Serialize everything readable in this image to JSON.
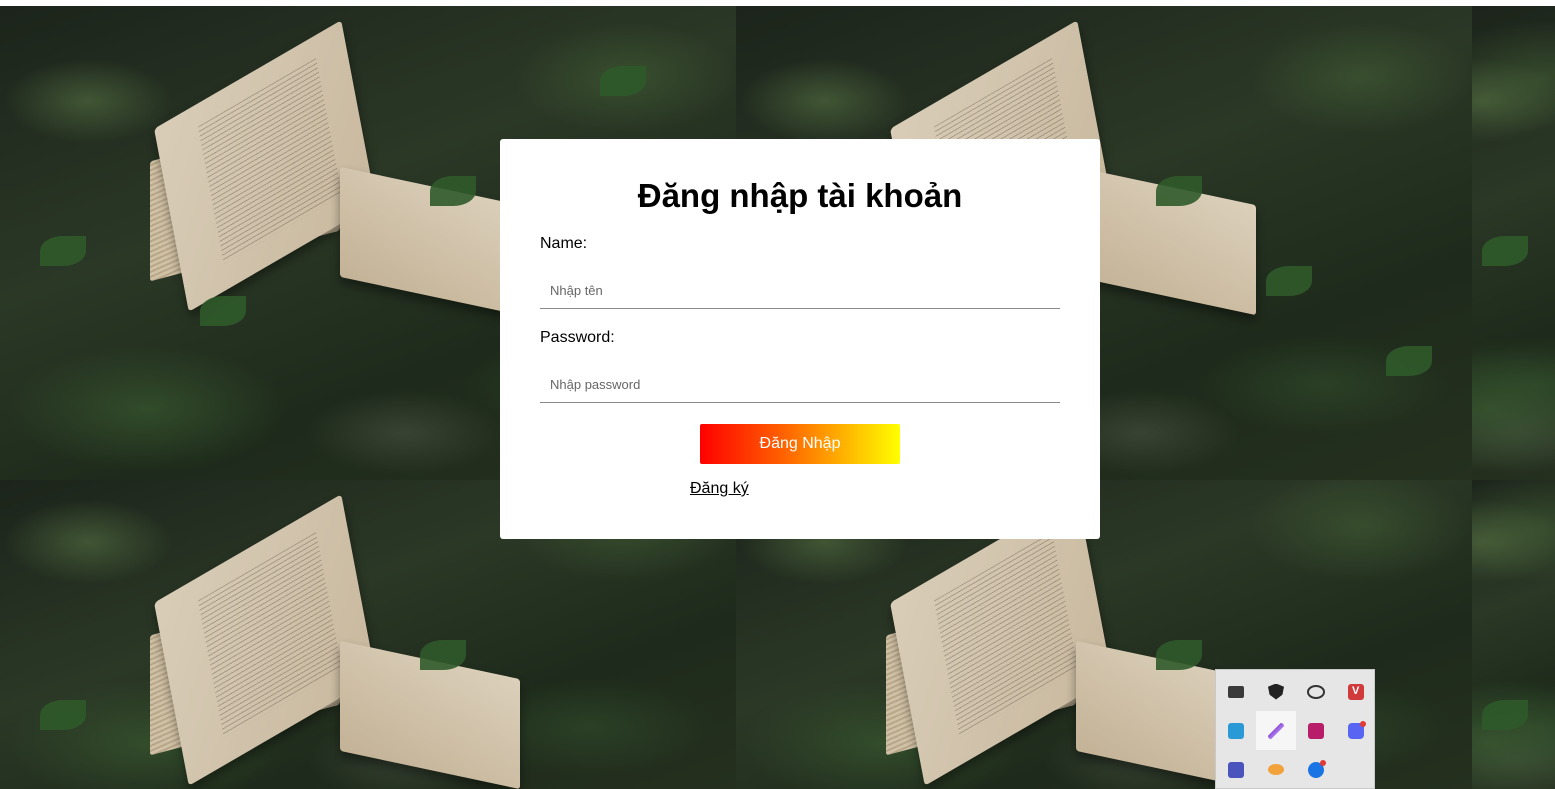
{
  "login": {
    "title": "Đăng nhập tài khoản",
    "name_label": "Name:",
    "name_placeholder": "Nhập tên",
    "password_label": "Password:",
    "password_placeholder": "Nhập password",
    "submit_label": "Đăng Nhập",
    "register_link": "Đăng ký"
  },
  "colors": {
    "button_gradient_start": "#ff0000",
    "button_gradient_end": "#ffff00",
    "card_background": "#ffffff"
  },
  "tray": {
    "icons": [
      "monitor-icon",
      "security-shield-icon",
      "cloud-offline-icon",
      "vivaldi-icon",
      "screenshot-tool-icon",
      "pen-icon",
      "app-icon",
      "discord-icon",
      "teams-icon",
      "pill-icon",
      "zalo-icon"
    ]
  }
}
